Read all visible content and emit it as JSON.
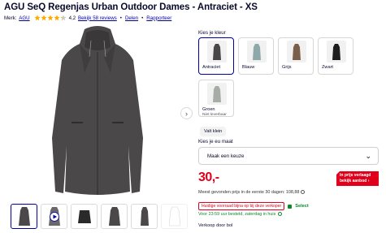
{
  "product": {
    "title": "AGU SeQ Regenjas Urban Outdoor Dames - Antraciet - XS",
    "brand_label": "Merk:",
    "brand": "AGU",
    "rating_value": "4,2",
    "rating_stars": 4.2,
    "reviews_link": "Bekijk 58 reviews",
    "share": "Delen",
    "report": "Rapporteer"
  },
  "colors": {
    "label": "Kies je kleur",
    "options": [
      {
        "name": "Antraciet",
        "sub": "",
        "selected": true,
        "swatch": "#4a4748"
      },
      {
        "name": "Blauw",
        "sub": "",
        "selected": false,
        "swatch": "#8fa9aa"
      },
      {
        "name": "Grijs",
        "sub": "",
        "selected": false,
        "swatch": "#7a5f4a"
      },
      {
        "name": "Zwart",
        "sub": "",
        "selected": false,
        "swatch": "#1e1e1e"
      },
      {
        "name": "Groen",
        "sub": "Niet leverbaar",
        "selected": false,
        "swatch": "#6a7466"
      }
    ]
  },
  "size_guide": "Valt klein",
  "size": {
    "label": "Kies je eu maat",
    "placeholder": "Maak een keuze"
  },
  "price": {
    "amount": "30,-",
    "promo_line1": "In prijs verlaagd",
    "promo_line2": "bekijk aanbod",
    "lowest": "Meest gevonden prijs in de eerste 30 dagen: 108,88",
    "badge": "Huidige voorraad bijna op bij deze verkoper",
    "select": "Select",
    "delivery": "Voor 23:59 uur besteld, zaterdag in huis",
    "seller": "Verkoop door bol"
  },
  "gallery": {
    "thumb_count": 6,
    "main_color": "#4a4748",
    "accent": "#0000a4"
  }
}
